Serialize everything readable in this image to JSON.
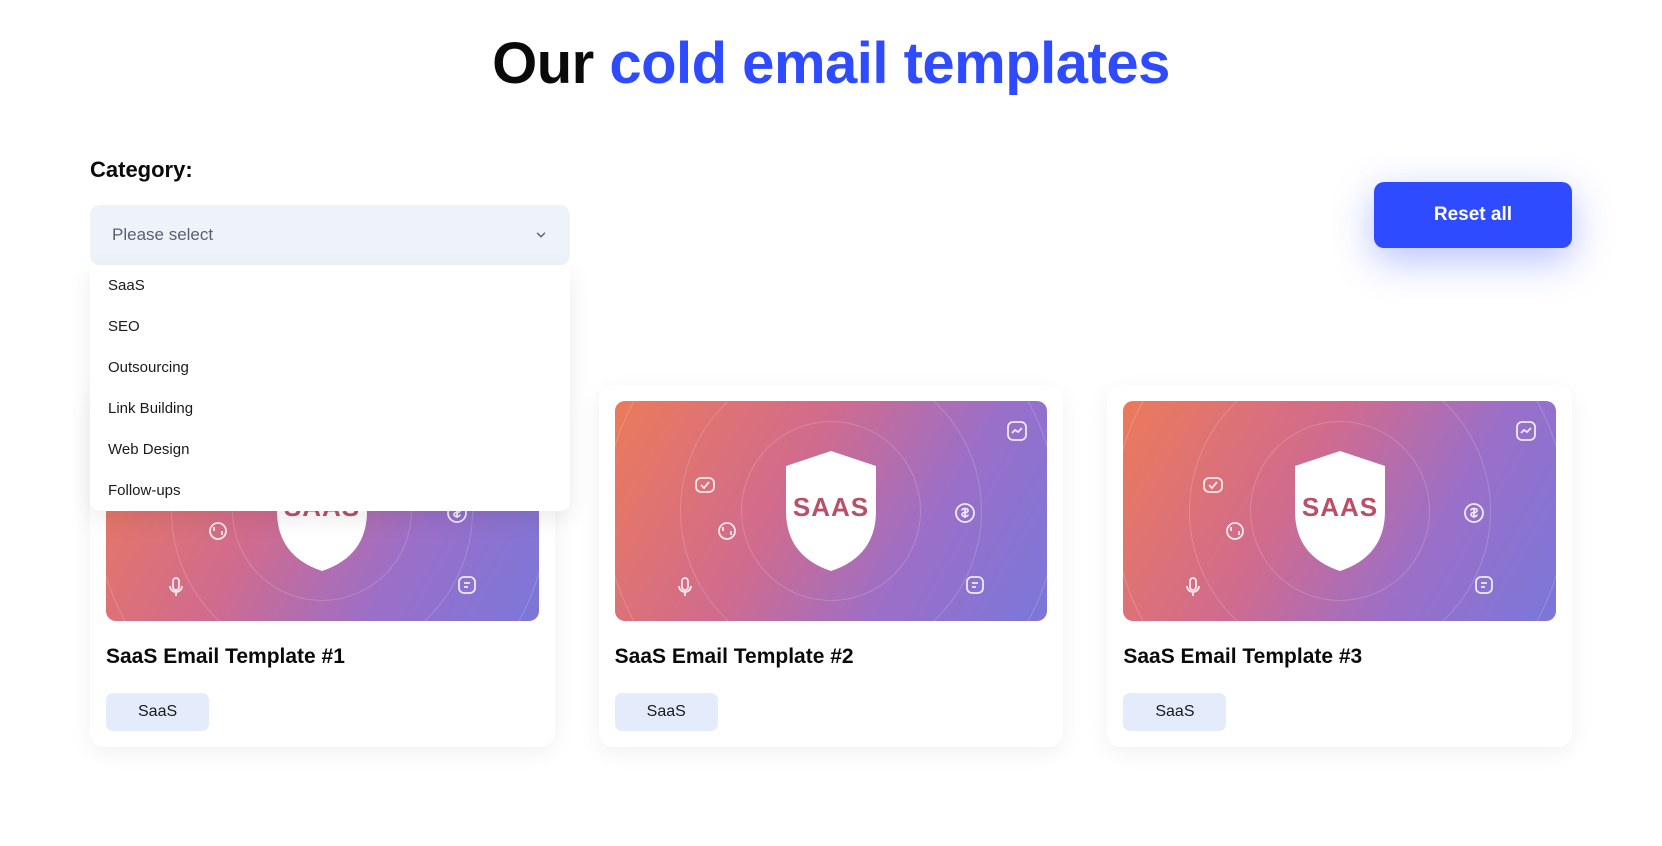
{
  "title": {
    "part1": "Our ",
    "part2": "cold email templates"
  },
  "filter": {
    "category_label": "Category:",
    "placeholder": "Please select",
    "options": [
      "SaaS",
      "SEO",
      "Outsourcing",
      "Link Building",
      "Web Design",
      "Follow-ups"
    ]
  },
  "reset_label": "Reset all",
  "shield_text": "SAAS",
  "cards": [
    {
      "title": "SaaS Email Template #1",
      "tag": "SaaS"
    },
    {
      "title": "SaaS Email Template #2",
      "tag": "SaaS"
    },
    {
      "title": "SaaS Email Template #3",
      "tag": "SaaS"
    }
  ]
}
